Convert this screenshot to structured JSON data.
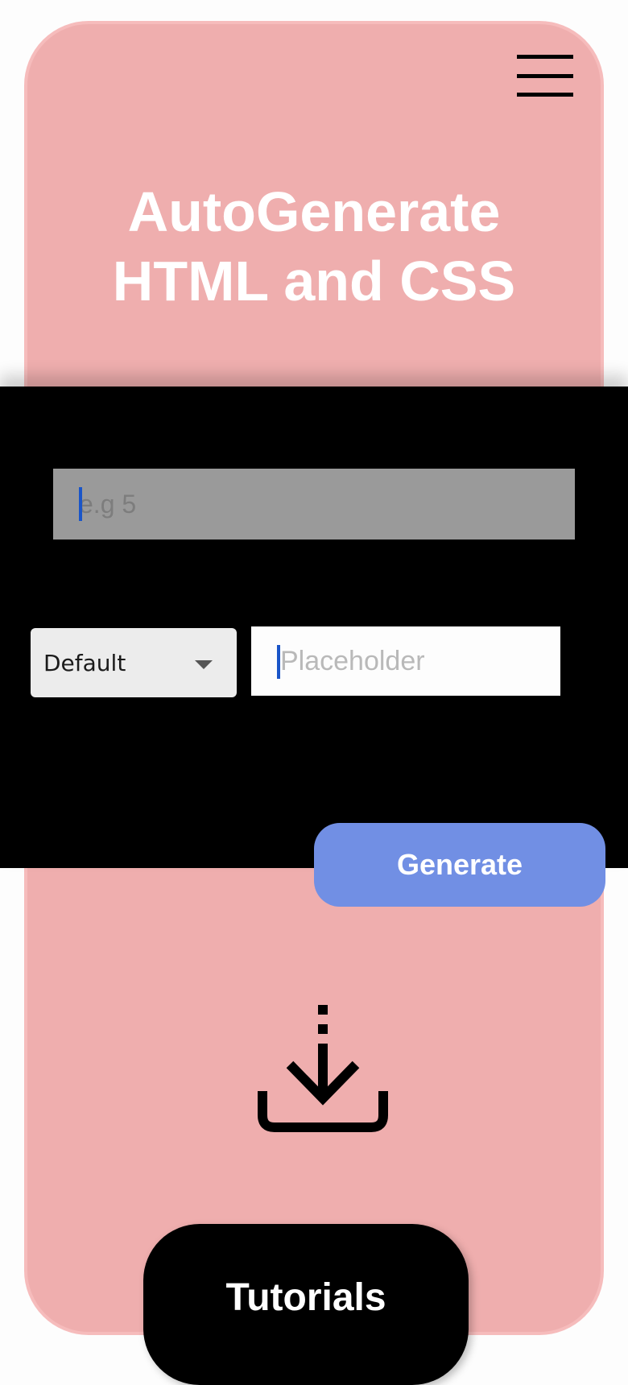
{
  "header": {
    "menu_icon": "hamburger-menu-icon",
    "title_line1": "AutoGenerate",
    "title_line2": "HTML and CSS"
  },
  "form": {
    "count_placeholder": "e.g 5",
    "count_value": "",
    "select_value": "Default",
    "text_placeholder": "Placeholder",
    "text_value": "",
    "generate_label": "Generate"
  },
  "download": {
    "icon": "download-icon"
  },
  "footer": {
    "tutorials_label": "Tutorials"
  },
  "colors": {
    "card_bg": "#efaeae",
    "panel_bg": "#000000",
    "accent": "#718fe4",
    "title_text": "#ffffff",
    "caret": "#1a55c8"
  }
}
